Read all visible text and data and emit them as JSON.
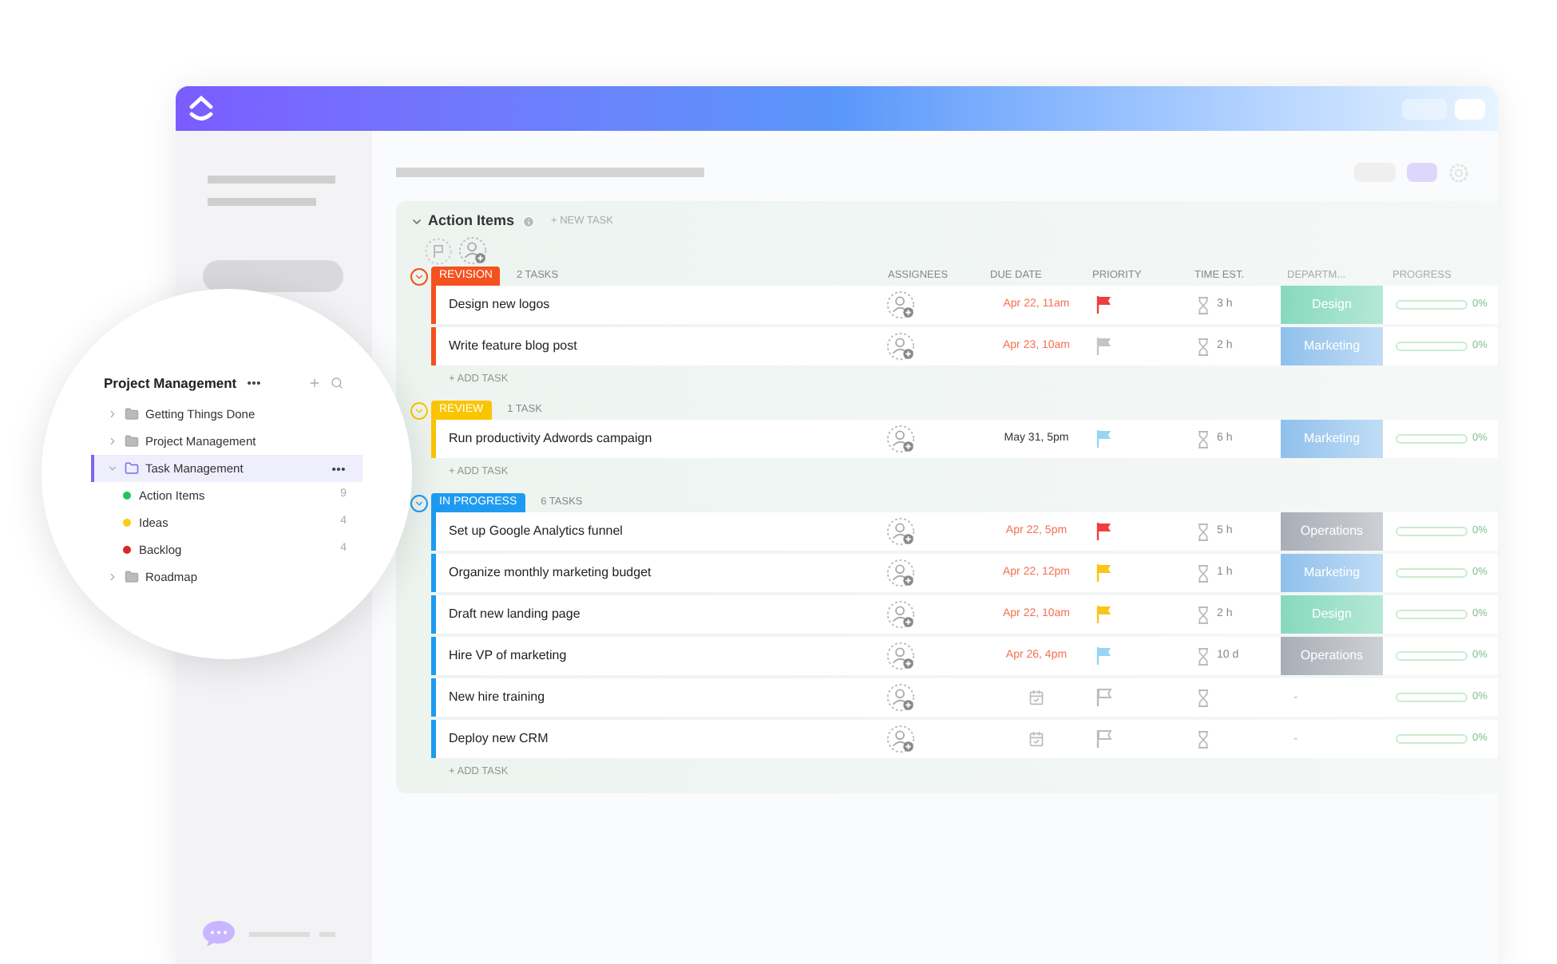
{
  "sidebar": {
    "title": "Project Management",
    "items": [
      {
        "kind": "folder",
        "label": "Getting Things Done",
        "expanded": false,
        "selected": false
      },
      {
        "kind": "folder",
        "label": "Project Management",
        "expanded": false,
        "selected": false
      },
      {
        "kind": "folder",
        "label": "Task Management",
        "expanded": true,
        "selected": true,
        "children": [
          {
            "kind": "list",
            "label": "Action Items",
            "color": "#22c55e",
            "count": "9"
          },
          {
            "kind": "list",
            "label": "Ideas",
            "color": "#facc15",
            "count": "4"
          },
          {
            "kind": "list",
            "label": "Backlog",
            "color": "#dc2626",
            "count": "4"
          }
        ]
      },
      {
        "kind": "folder",
        "label": "Roadmap",
        "expanded": false,
        "selected": false
      }
    ]
  },
  "list": {
    "title": "Action Items",
    "new_task": "+ NEW TASK",
    "columns": [
      "ASSIGNEES",
      "DUE DATE",
      "PRIORITY",
      "TIME EST.",
      "DEPARTM...",
      "PROGRESS"
    ],
    "groups": [
      {
        "status": "REVISION",
        "color": "#f4511e",
        "count": "2 TASKS",
        "add_task": "+ ADD TASK",
        "tasks": [
          {
            "name": "Design new logos",
            "due": "Apr 22, 11am",
            "overdue": true,
            "priority": {
              "color": "#f03e3e"
            },
            "time": "3 h",
            "department": {
              "label": "Design",
              "kind": "design"
            },
            "progress": {
              "level": 0,
              "reading": "0%"
            }
          },
          {
            "name": "Write feature blog post",
            "due": "Apr 23, 10am",
            "overdue": true,
            "priority": {
              "color": "#c4c4c4"
            },
            "time": "2 h",
            "department": {
              "label": "Marketing",
              "kind": "marketing"
            },
            "progress": {
              "level": 0,
              "reading": "0%"
            }
          }
        ]
      },
      {
        "status": "REVIEW",
        "color": "#fbc400",
        "count": "1 TASK",
        "add_task": "+ ADD TASK",
        "tasks": [
          {
            "name": "Run productivity Adwords campaign",
            "due": "May 31, 5pm",
            "overdue": false,
            "priority": {
              "color": "#99d4f5"
            },
            "time": "6 h",
            "department": {
              "label": "Marketing",
              "kind": "marketing"
            },
            "progress": {
              "level": 0,
              "reading": "0%"
            }
          }
        ]
      },
      {
        "status": "IN PROGRESS",
        "color": "#1e9bf0",
        "count": "6 TASKS",
        "add_task": "+ ADD TASK",
        "tasks": [
          {
            "name": "Set up Google Analytics funnel",
            "due": "Apr 22, 5pm",
            "overdue": true,
            "priority": {
              "color": "#f03e3e"
            },
            "time": "5 h",
            "department": {
              "label": "Operations",
              "kind": "operations"
            },
            "progress": {
              "level": 0,
              "reading": "0%"
            }
          },
          {
            "name": "Organize monthly marketing budget",
            "due": "Apr 22, 12pm",
            "overdue": true,
            "priority": {
              "color": "#fcc419"
            },
            "time": "1 h",
            "department": {
              "label": "Marketing",
              "kind": "marketing"
            },
            "progress": {
              "level": 0,
              "reading": "0%"
            }
          },
          {
            "name": "Draft new landing page",
            "due": "Apr 22, 10am",
            "overdue": true,
            "priority": {
              "color": "#fcc419"
            },
            "time": "2 h",
            "department": {
              "label": "Design",
              "kind": "design"
            },
            "progress": {
              "level": 0,
              "reading": "0%"
            }
          },
          {
            "name": "Hire VP of marketing",
            "due": "Apr 26, 4pm",
            "overdue": true,
            "priority": {
              "color": "#99d4f5"
            },
            "time": "10 d",
            "department": {
              "label": "Operations",
              "kind": "operations"
            },
            "progress": {
              "level": 0,
              "reading": "0%"
            }
          },
          {
            "name": "New hire training",
            "department": {
              "label": "-",
              "kind": "empty"
            },
            "progress": {
              "level": 0,
              "reading": "0%"
            }
          },
          {
            "name": "Deploy new CRM",
            "department": {
              "label": "-",
              "kind": "empty"
            },
            "progress": {
              "level": 0,
              "reading": "0%"
            }
          }
        ]
      }
    ]
  }
}
